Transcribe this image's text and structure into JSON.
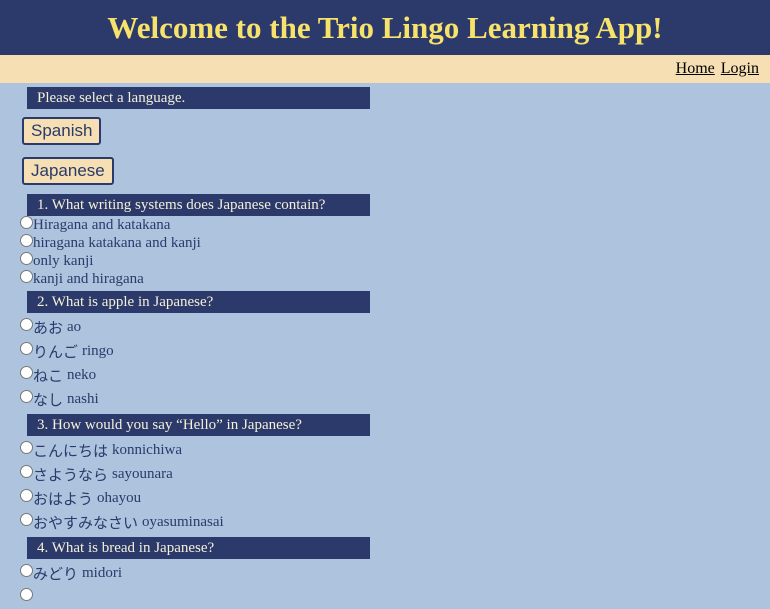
{
  "header": {
    "title": "Welcome to the Trio Lingo Learning App!"
  },
  "nav": {
    "home": "Home",
    "login": "Login"
  },
  "prompt": "Please select a language.",
  "languages": [
    "Spanish",
    "Japanese"
  ],
  "questions": [
    {
      "text": "1. What writing systems does Japanese contain?",
      "options": [
        {
          "label": "Hiragana and katakana"
        },
        {
          "label": "hiragana katakana and kanji"
        },
        {
          "label": "only kanji"
        },
        {
          "label": "kanji and hiragana"
        }
      ]
    },
    {
      "text": "2. What is apple in Japanese?",
      "options": [
        {
          "jp": "あお",
          "romaji": "ao"
        },
        {
          "jp": "りんご",
          "romaji": "ringo"
        },
        {
          "jp": "ねこ",
          "romaji": "neko"
        },
        {
          "jp": "なし",
          "romaji": "nashi"
        }
      ]
    },
    {
      "text": "3. How would you say “Hello” in Japanese?",
      "options": [
        {
          "jp": "こんにちは",
          "romaji": "konnichiwa"
        },
        {
          "jp": "さようなら",
          "romaji": "sayounara"
        },
        {
          "jp": "おはよう",
          "romaji": "ohayou"
        },
        {
          "jp": "おやすみなさい",
          "romaji": "oyasuminasai"
        }
      ]
    },
    {
      "text": "4. What is bread in Japanese?",
      "options": [
        {
          "jp": "みどり",
          "romaji": "midori"
        }
      ]
    }
  ]
}
